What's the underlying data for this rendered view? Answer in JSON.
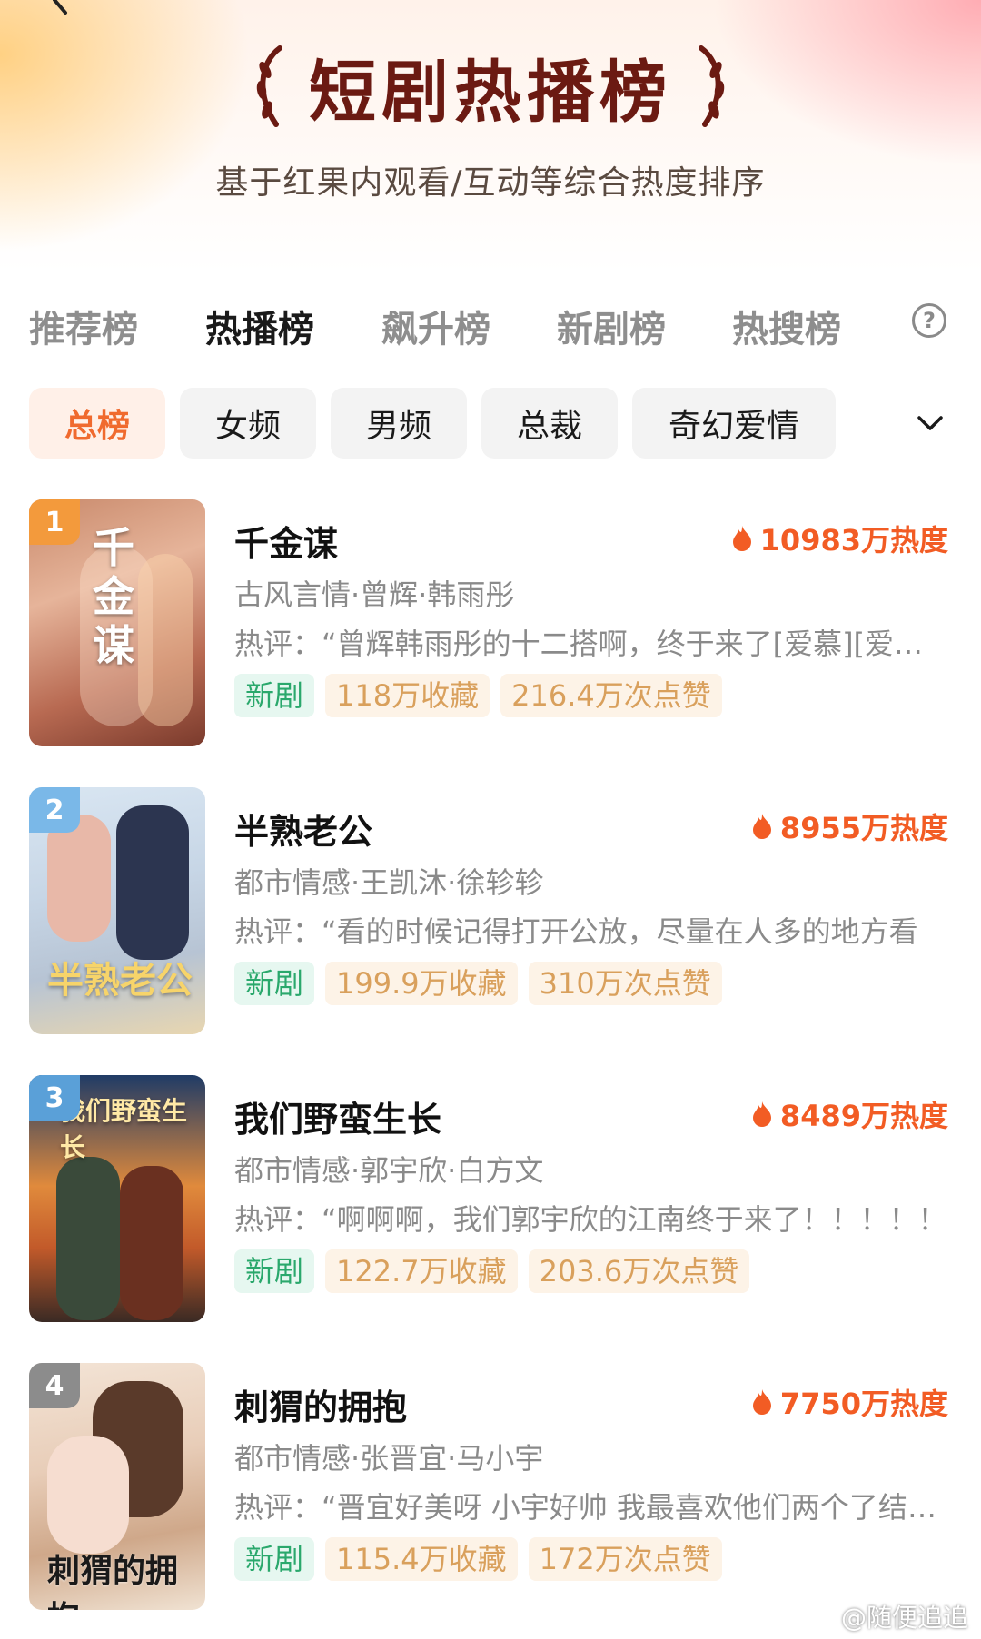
{
  "header": {
    "title": "短剧热播榜",
    "subtitle": "基于红果内观看/互动等综合热度排序"
  },
  "tabs": [
    {
      "label": "推荐榜",
      "active": false
    },
    {
      "label": "热播榜",
      "active": true
    },
    {
      "label": "飙升榜",
      "active": false
    },
    {
      "label": "新剧榜",
      "active": false
    },
    {
      "label": "热搜榜",
      "active": false
    }
  ],
  "help_label": "?",
  "chips": [
    {
      "label": "总榜",
      "active": true
    },
    {
      "label": "女频",
      "active": false
    },
    {
      "label": "男频",
      "active": false
    },
    {
      "label": "总裁",
      "active": false
    },
    {
      "label": "奇幻爱情",
      "active": false
    }
  ],
  "items": [
    {
      "rank": "1",
      "title": "千金谋",
      "heat": "10983万热度",
      "meta": "古风言情·曾辉·韩雨彤",
      "review": "热评：“曾辉韩雨彤的十二搭啊，终于来了[爱慕][爱慕][爱慕]",
      "tags": [
        "新剧",
        "118万收藏",
        "216.4万次点赞"
      ],
      "poster_text": "千金谋",
      "rank_color": "#f39a3c"
    },
    {
      "rank": "2",
      "title": "半熟老公",
      "heat": "8955万热度",
      "meta": "都市情感·王凯沐·徐轸轸",
      "review": "热评：“看的时候记得打开公放，尽量在人多的地方看",
      "tags": [
        "新剧",
        "199.9万收藏",
        "310万次点赞"
      ],
      "poster_text": "半熟老公",
      "rank_color": "#7ab8e8"
    },
    {
      "rank": "3",
      "title": "我们野蛮生长",
      "heat": "8489万热度",
      "meta": "都市情感·郭宇欣·白方文",
      "review": "热评：“啊啊啊，我们郭宇欣的江南终于来了！！！！！",
      "tags": [
        "新剧",
        "122.7万收藏",
        "203.6万次点赞"
      ],
      "poster_text": "我们野蛮生长",
      "rank_color": "#5aa0d8"
    },
    {
      "rank": "4",
      "title": "刺猬的拥抱",
      "heat": "7750万热度",
      "meta": "都市情感·张晋宜·马小宇",
      "review": "热评：“晋宜好美呀 小宇好帅 我最喜欢他们两个了结局太好了",
      "tags": [
        "新剧",
        "115.4万收藏",
        "172万次点赞"
      ],
      "poster_text": "刺猬的拥抱",
      "rank_color": "#8c8c8c"
    }
  ],
  "watermark": "@随便追追",
  "icons": {
    "back": "back-arrow-icon",
    "laurel": "laurel-icon",
    "help": "help-icon",
    "chevron": "chevron-down-icon",
    "fire": "fire-icon",
    "weibo": "weibo-icon"
  },
  "colors": {
    "accent": "#f25c24",
    "title": "#6b1a12",
    "new_tag": "#2aa86c",
    "stat_tag": "#d9a05c"
  }
}
